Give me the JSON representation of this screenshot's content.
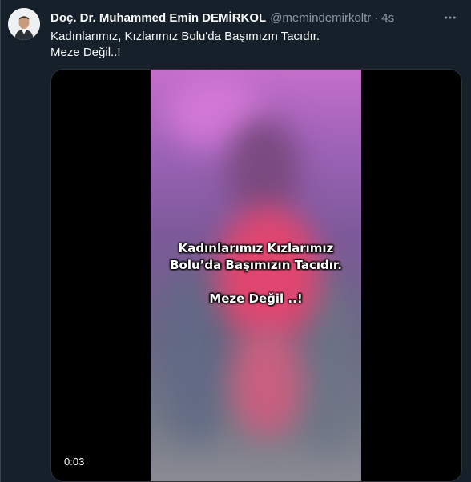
{
  "tweet": {
    "author_name": "Doç. Dr. Muhammed Emin DEMİRKOL",
    "handle": "@memindemirkoltr",
    "separator": "·",
    "time": "4s",
    "text_line1": "Kadınlarımız, Kızlarımız Bolu'da Başımızın Tacıdır.",
    "text_line2": "Meze Değil..!",
    "more_icon": "more-icon"
  },
  "video": {
    "caption_line1": "Kadınlarımız Kızlarımız",
    "caption_line2": "Bolu’da Başımızın Tacıdır.",
    "caption_line3": "Meze Değil ..!",
    "duration": "0:03"
  },
  "colors": {
    "background": "#15202b",
    "secondary_text": "#8b98a5",
    "primary_text": "#f7f9f9"
  }
}
